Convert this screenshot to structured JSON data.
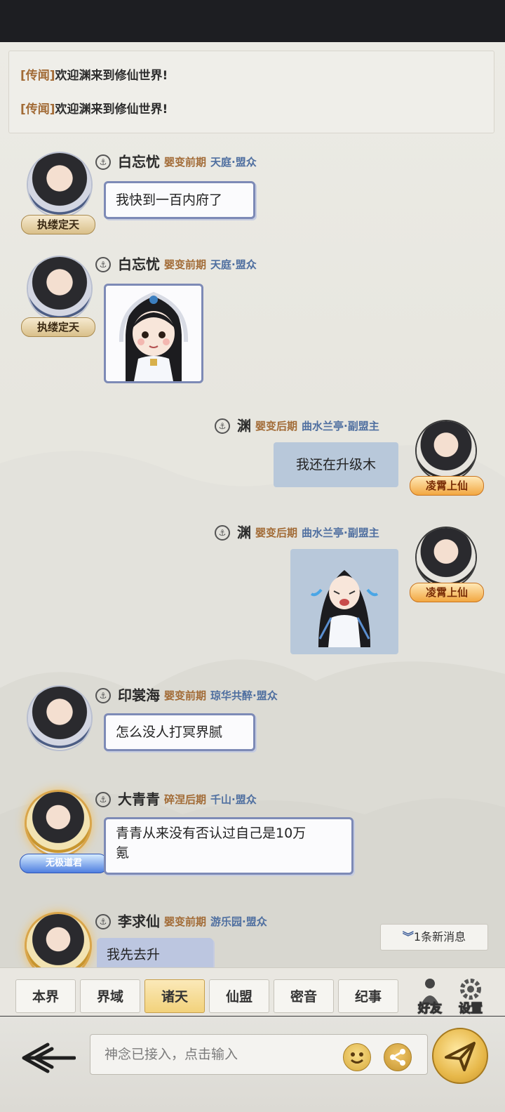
{
  "news": {
    "items": [
      {
        "tag": "[传闻]",
        "text": "欢迎渊来到修仙世界!"
      },
      {
        "tag": "[传闻]",
        "text": "欢迎渊来到修仙世界!"
      }
    ]
  },
  "messages": [
    {
      "side": "left",
      "name": "白忘忧",
      "realm": "婴变前期",
      "guild": "天庭·盟众",
      "badge": "执缕定天",
      "text": "我快到一百内府了"
    },
    {
      "side": "left",
      "name": "白忘忧",
      "realm": "婴变前期",
      "guild": "天庭·盟众",
      "badge": "执缕定天",
      "sticker": "girl-sticker"
    },
    {
      "side": "right",
      "name": "渊",
      "realm": "婴变后期",
      "guild": "曲水兰亭·副盟主",
      "badge": "凌霄上仙",
      "text": "我还在升级木"
    },
    {
      "side": "right",
      "name": "渊",
      "realm": "婴变后期",
      "guild": "曲水兰亭·副盟主",
      "badge": "凌霄上仙",
      "sticker": "crying-sticker"
    },
    {
      "side": "left",
      "name": "印裳海",
      "realm": "婴变前期",
      "guild": "琼华共醉·盟众",
      "text": "怎么没人打冥界腻"
    },
    {
      "side": "left",
      "name": "大青青",
      "realm": "碎涅后期",
      "guild": "千山·盟众",
      "badge": "无极道君",
      "text_line1": "青青从来没有否认过自己是10万",
      "text_line2": "氪"
    },
    {
      "side": "left",
      "name": "李求仙",
      "realm": "婴变前期",
      "guild": "游乐园·盟众",
      "text": "我先去升"
    }
  ],
  "new_messages": "1条新消息",
  "tabs": [
    "本界",
    "界域",
    "诸天",
    "仙盟",
    "密音",
    "纪事"
  ],
  "active_tab": "诸天",
  "side_buttons": {
    "friends": "好友",
    "settings": "设置"
  },
  "input": {
    "placeholder": "神念已接入，点击输入"
  },
  "colors": {
    "realm": "#a26b36",
    "guild": "#4f6fa0",
    "bubble_border": "#7d8ab6",
    "own_bubble": "#b8c8da"
  }
}
